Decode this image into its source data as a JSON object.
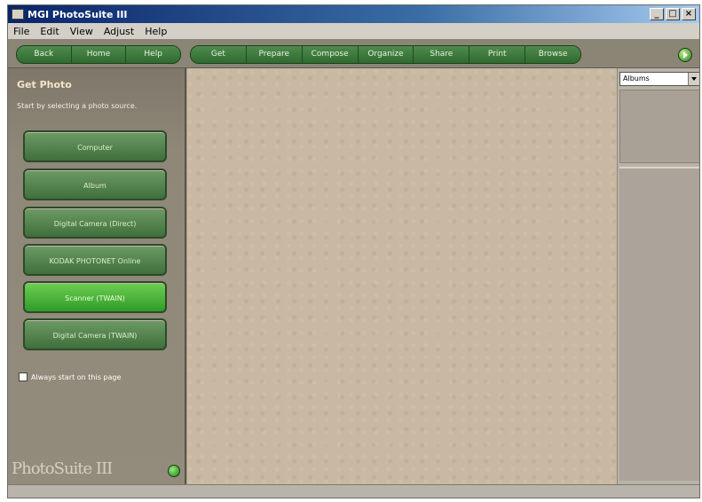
{
  "window": {
    "title": "MGI PhotoSuite III"
  },
  "menu": [
    "File",
    "Edit",
    "View",
    "Adjust",
    "Help"
  ],
  "nav_buttons": [
    "Back",
    "Home",
    "Help"
  ],
  "main_tabs": [
    "Get",
    "Prepare",
    "Compose",
    "Organize",
    "Share",
    "Print",
    "Browse"
  ],
  "left_panel": {
    "title": "Get Photo",
    "subtitle": "Start by selecting a photo source.",
    "sources": [
      "Computer",
      "Album",
      "Digital Camera (Direct)",
      "KODAK PHOTONET Online",
      "Scanner (TWAIN)",
      "Digital Camera (TWAIN)"
    ],
    "always_start_label": "Always start on this page",
    "brand": "PhotoSuite III"
  },
  "right_panel": {
    "album_value": "Albums"
  },
  "colors": {
    "accent_green": "#2f6b2f",
    "active_green": "#2f9b2a",
    "canvas": "#c9b9a2"
  }
}
